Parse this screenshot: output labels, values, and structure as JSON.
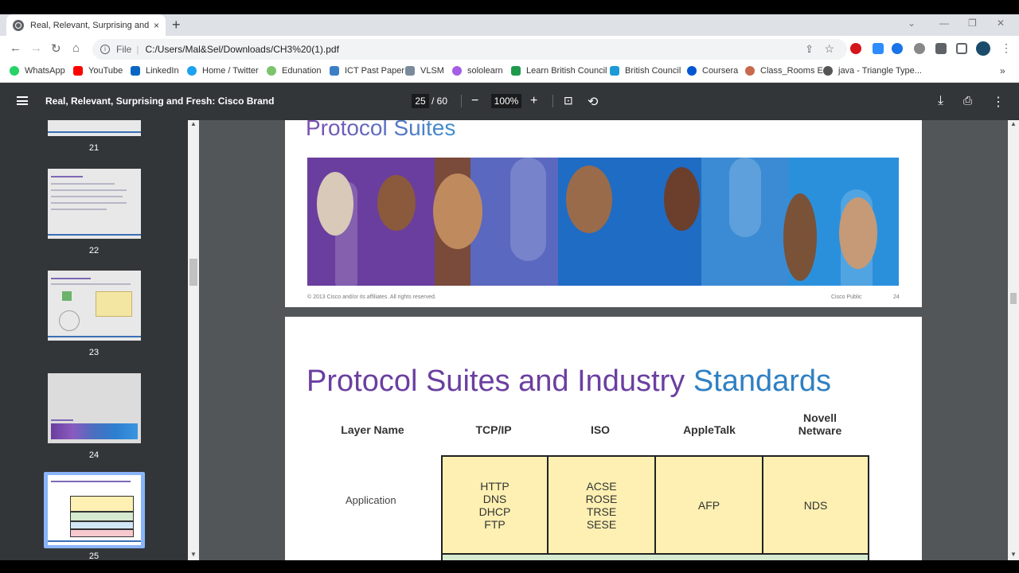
{
  "browser": {
    "tab_title": "Real, Relevant, Surprising and Fresh: Cisco Brand",
    "tab_close": "×",
    "new_tab": "+",
    "address_scheme": "File",
    "address_url": "C:/Users/Mal&Sel/Downloads/CH3%20(1).pdf"
  },
  "bookmarks": [
    {
      "label": "WhatsApp",
      "color": "#25d366"
    },
    {
      "label": "YouTube",
      "color": "#ff0000"
    },
    {
      "label": "LinkedIn",
      "color": "#0a66c2"
    },
    {
      "label": "Home / Twitter",
      "color": "#1da1f2"
    },
    {
      "label": "Edunation",
      "color": "#7cc36b"
    },
    {
      "label": "ICT Past Paper",
      "color": "#3d7fc6"
    },
    {
      "label": "VLSM",
      "color": "#7a8b9c"
    },
    {
      "label": "sololearn",
      "color": "#a45ee5"
    },
    {
      "label": "Learn British Council",
      "color": "#1f9a4c"
    },
    {
      "label": "British Council",
      "color": "#1c9ad6"
    },
    {
      "label": "Coursera",
      "color": "#0056d2"
    },
    {
      "label": "Class_Rooms E",
      "color": "#c7694c"
    },
    {
      "label": "java - Triangle Type...",
      "color": "#555555"
    }
  ],
  "pdf": {
    "title": "Real, Relevant, Surprising and Fresh: Cisco Brand",
    "current_page": "25",
    "total_pages": "/ 60",
    "zoom": "100%"
  },
  "thumbnails": [
    {
      "number": "21"
    },
    {
      "number": "22"
    },
    {
      "number": "23"
    },
    {
      "number": "24"
    },
    {
      "number": "25",
      "selected": true
    }
  ],
  "page24": {
    "title": "Protocol Suites",
    "copyright": "© 2013 Cisco and/or its affiliates. All rights reserved.",
    "classification": "Cisco Public",
    "page_number": "24"
  },
  "page25": {
    "title_part1": "Protocol Suites and Industry ",
    "title_part2": "Standards",
    "columns": [
      "Layer Name",
      "TCP/IP",
      "ISO",
      "AppleTalk",
      "Novell Netware"
    ],
    "rows": [
      {
        "layer": "Application",
        "tcpip": "HTTP DNS DHCP FTP",
        "iso": "ACSE ROSE TRSE SESE",
        "appletalk": "AFP",
        "novell": "NDS"
      }
    ]
  },
  "colors": {
    "pdf_toolbar": "#323639",
    "viewer_bg": "#525659",
    "title_purple": "#6b3fa0",
    "title_blue": "#2f80c3",
    "table_yellow": "#fdf0b2"
  }
}
